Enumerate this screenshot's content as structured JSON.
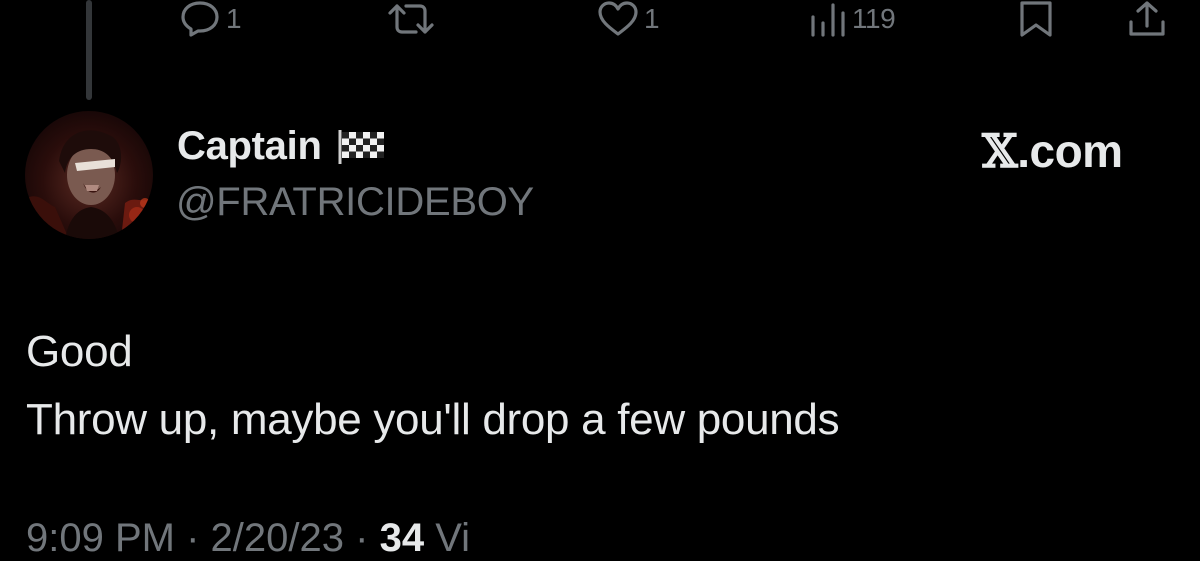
{
  "actions": {
    "reply_count": "1",
    "retweet_count": "",
    "like_count": "1",
    "view_count": "119"
  },
  "author": {
    "display_name": "Captain",
    "handle": "@FRATRICIDEBOY"
  },
  "watermark": {
    "symbol": "𝕏",
    "text": ".com"
  },
  "tweet": {
    "lines": [
      "Good",
      "Throw up, maybe you'll drop a few pounds"
    ]
  },
  "meta": {
    "time": "9:09 PM",
    "separator": "·",
    "date": "2/20/23",
    "views_count": "34",
    "views_label": "Vi"
  },
  "colors": {
    "background": "#000000",
    "primary_text": "#e7e9ea",
    "secondary_text": "#71767b",
    "thread_line": "#333639"
  },
  "icons": {
    "reply": "reply-icon",
    "retweet": "retweet-icon",
    "like": "heart-icon",
    "views": "views-chart-icon",
    "bookmark": "bookmark-icon",
    "share": "share-icon",
    "flag": "checkered-flag-icon"
  }
}
